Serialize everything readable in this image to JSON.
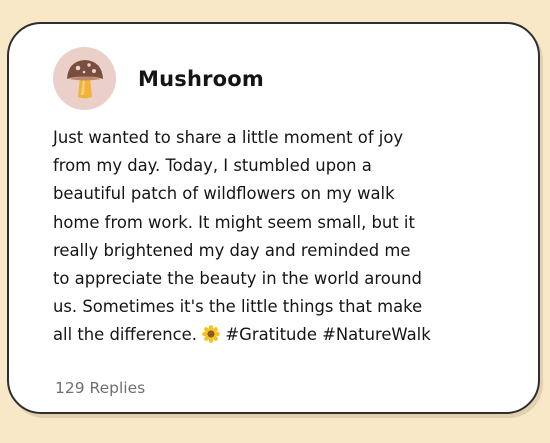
{
  "post": {
    "author": "Mushroom",
    "avatar_icon": "mushroom-icon",
    "lines": [
      "Just wanted to share a little moment of joy",
      "from my day. Today, I stumbled upon a",
      "beautiful patch of wildflowers on my walk",
      "home from work. It might seem small, but it",
      "really brightened my day and reminded me",
      "to appreciate the beauty in the world around",
      "us. Sometimes it's the little things that make",
      "all the difference."
    ],
    "emoji_icon": "sunflower-icon",
    "hashtags": "#Gratitude #NatureWalk",
    "replies_label": "129 Replies"
  },
  "colors": {
    "background": "#f9e8c8",
    "card": "#ffffff",
    "card_border": "#2e2e2e",
    "avatar_bg": "#ead0c9",
    "mushroom_cap": "#7a4e3f",
    "mushroom_stem": "#f2b33d",
    "replies_text": "#6f6f6f"
  }
}
